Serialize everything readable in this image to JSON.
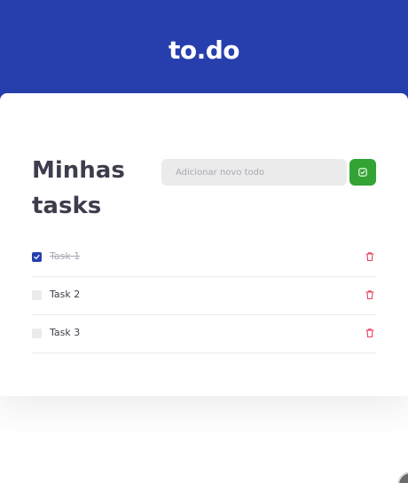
{
  "header": {
    "title": "to.do"
  },
  "main": {
    "title": "Minhas tasks",
    "new_todo": {
      "placeholder": "Adicionar novo todo",
      "value": ""
    },
    "add_button": {
      "icon": "check-square-icon",
      "color": "#33a434"
    },
    "tasks": [
      {
        "label": "Task 1",
        "completed": true
      },
      {
        "label": "Task 2",
        "completed": false
      },
      {
        "label": "Task 3",
        "completed": false
      }
    ]
  },
  "colors": {
    "header_bg": "#273fad",
    "checked": "#273fad",
    "trash": "#e83f5b",
    "text": "#3d3d4d",
    "muted": "#a8a8b3"
  }
}
